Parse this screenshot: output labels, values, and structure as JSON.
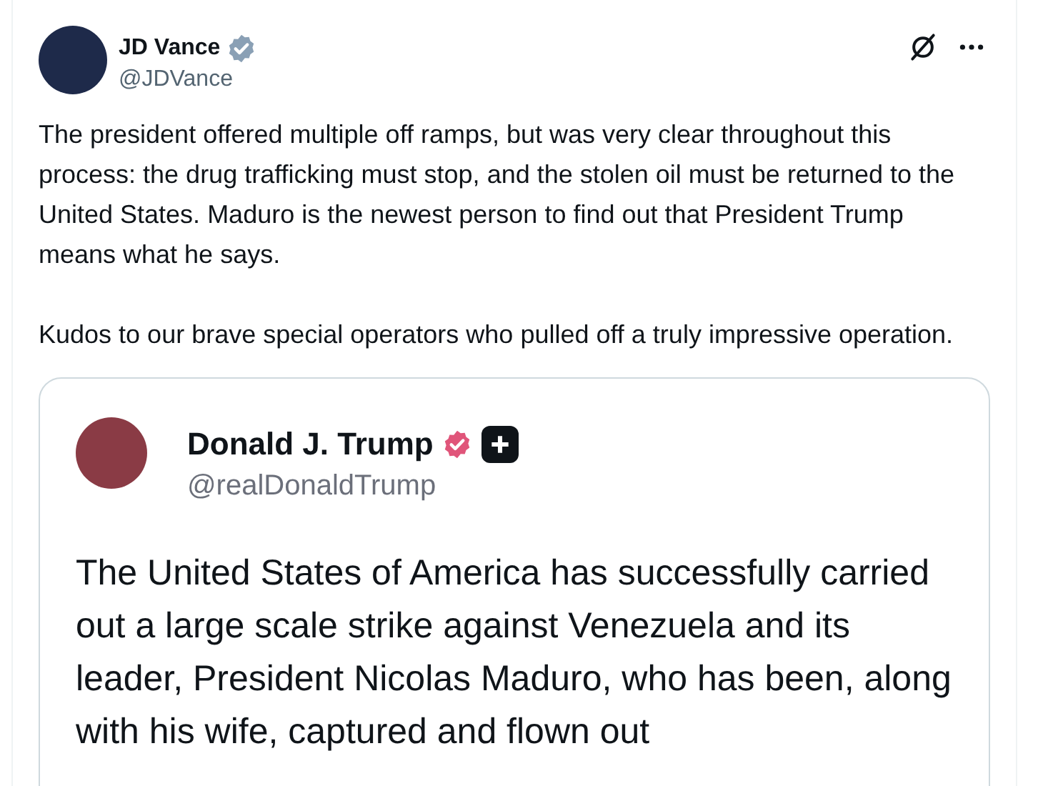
{
  "post": {
    "author": {
      "name": "JD Vance",
      "handle": "@JDVance",
      "verified": true
    },
    "paragraphs": [
      "The president offered multiple off ramps, but was very clear throughout this process: the drug trafficking must stop, and the stolen oil must be returned to the United States. Maduro is the newest person to find out that President Trump means what he says.",
      "Kudos to our brave special operators who pulled off a truly impressive operation."
    ],
    "quoted": {
      "author": {
        "name": "Donald J. Trump",
        "handle": "@realDonaldTrump",
        "verified": true
      },
      "text": "The United States of America has successfully carried out a large scale strike against Venezuela and its leader, President Nicolas Maduro, who has been, along with his wife, captured and flown out"
    }
  }
}
